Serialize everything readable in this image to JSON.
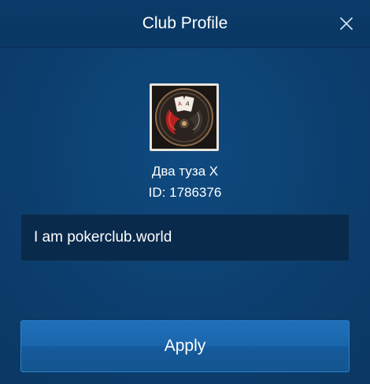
{
  "dialog": {
    "title": "Club Profile",
    "close_icon": "close-icon"
  },
  "club": {
    "avatar_icon": "club-logo-image",
    "name": "Два туза X",
    "id_text": "ID: 1786376",
    "description": "I am pokerclub.world"
  },
  "actions": {
    "apply_label": "Apply"
  },
  "colors": {
    "background": "#0c3d6c",
    "input_background": "#0a2a4c",
    "button": "#1a66ac",
    "text": "#ffffff"
  }
}
